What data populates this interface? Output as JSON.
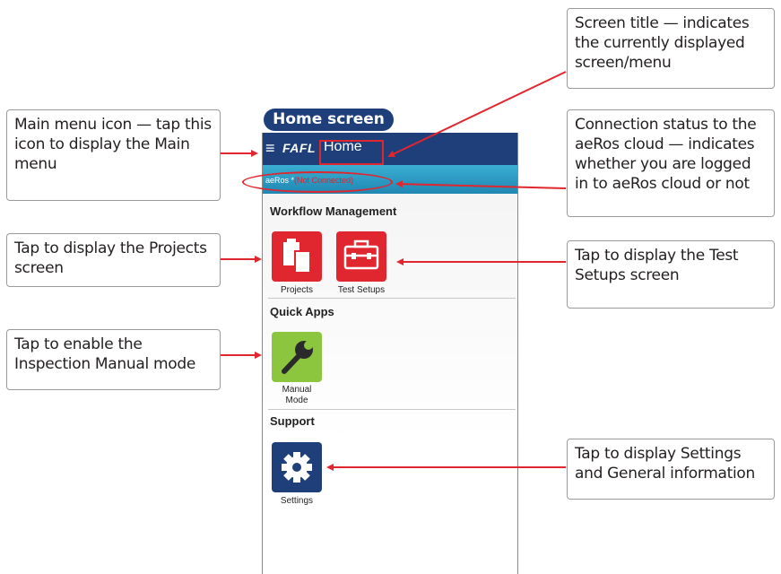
{
  "badge": "Home screen",
  "app": {
    "logo": "FAFL",
    "title": "Home",
    "status_prefix": "aeRos *",
    "status_state": "(Not Connected)"
  },
  "sections": {
    "workflow": "Workflow Management",
    "quick_apps": "Quick Apps",
    "support": "Support"
  },
  "tiles": {
    "projects": "Projects",
    "test_setups": "Test Setups",
    "manual_mode_line1": "Manual",
    "manual_mode_line2": "Mode",
    "settings": "Settings"
  },
  "callouts": {
    "screen_title": "Screen title — indicates the currently displayed screen/menu",
    "main_menu": "Main menu icon — tap this icon to display the Main menu",
    "connection": "Connection status to the aeRos cloud — indicates whether you are logged in to aeRos cloud or not",
    "projects": "Tap to display the Projects screen",
    "test_setups": "Tap to display the Test Setups screen",
    "manual": "Tap to enable the Inspection Manual mode",
    "settings": "Tap to display Settings and General information"
  },
  "colors": {
    "appbar": "#1e3f7a",
    "statusbar": "#2a9bc6",
    "tile_red": "#e0262e",
    "tile_green": "#8cc63f",
    "tile_navy": "#1e3f7a",
    "arrow": "#e0262e"
  }
}
